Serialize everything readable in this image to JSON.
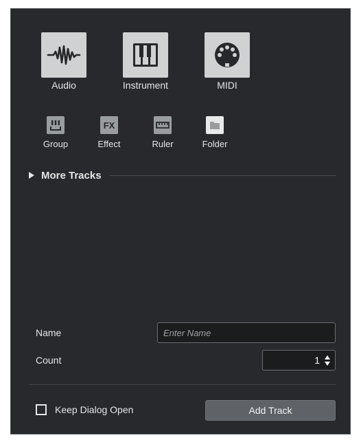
{
  "track_types": [
    {
      "label": "Audio",
      "icon": "audio-waveform-icon"
    },
    {
      "label": "Instrument",
      "icon": "piano-keys-icon"
    },
    {
      "label": "MIDI",
      "icon": "midi-connector-icon"
    }
  ],
  "small_types": [
    {
      "label": "Group",
      "icon": "group-fader-icon"
    },
    {
      "label": "Effect",
      "icon": "fx-icon",
      "icon_text": "FX"
    },
    {
      "label": "Ruler",
      "icon": "ruler-icon"
    },
    {
      "label": "Folder",
      "icon": "folder-icon",
      "selected": true
    }
  ],
  "more_tracks": {
    "label": "More Tracks"
  },
  "name_field": {
    "label": "Name",
    "placeholder": "Enter Name",
    "value": ""
  },
  "count_field": {
    "label": "Count",
    "value": "1"
  },
  "keep_dialog_open": {
    "label": "Keep Dialog Open",
    "checked": false
  },
  "add_track": {
    "label": "Add Track"
  },
  "colors": {
    "background": "#27292c",
    "icon_tile": "#cfd1d2",
    "small_icon_tile": "#9a9da0",
    "selected_tile": "#e7e9ea",
    "text": "#e4e6e7",
    "button": "#5f6266"
  }
}
